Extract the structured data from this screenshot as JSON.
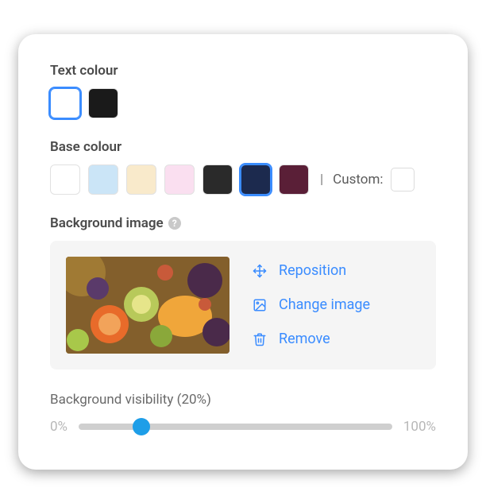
{
  "textColour": {
    "label": "Text colour",
    "options": [
      {
        "color": "#ffffff",
        "selected": true
      },
      {
        "color": "#1a1a1a",
        "selected": false
      }
    ]
  },
  "baseColour": {
    "label": "Base colour",
    "options": [
      {
        "color": "#ffffff",
        "selected": false
      },
      {
        "color": "#cbe5f7",
        "selected": false
      },
      {
        "color": "#f9eacb",
        "selected": false
      },
      {
        "color": "#fadff0",
        "selected": false
      },
      {
        "color": "#2a2a2a",
        "selected": false
      },
      {
        "color": "#1c2a4e",
        "selected": true
      },
      {
        "color": "#5a1f37",
        "selected": false
      }
    ],
    "customLabel": "Custom:",
    "customColor": "#ffffff"
  },
  "backgroundImage": {
    "label": "Background image",
    "repositionLabel": "Reposition",
    "changeLabel": "Change image",
    "removeLabel": "Remove"
  },
  "visibility": {
    "labelPrefix": "Background visibility",
    "percent": 20,
    "minLabel": "0%",
    "maxLabel": "100%"
  }
}
